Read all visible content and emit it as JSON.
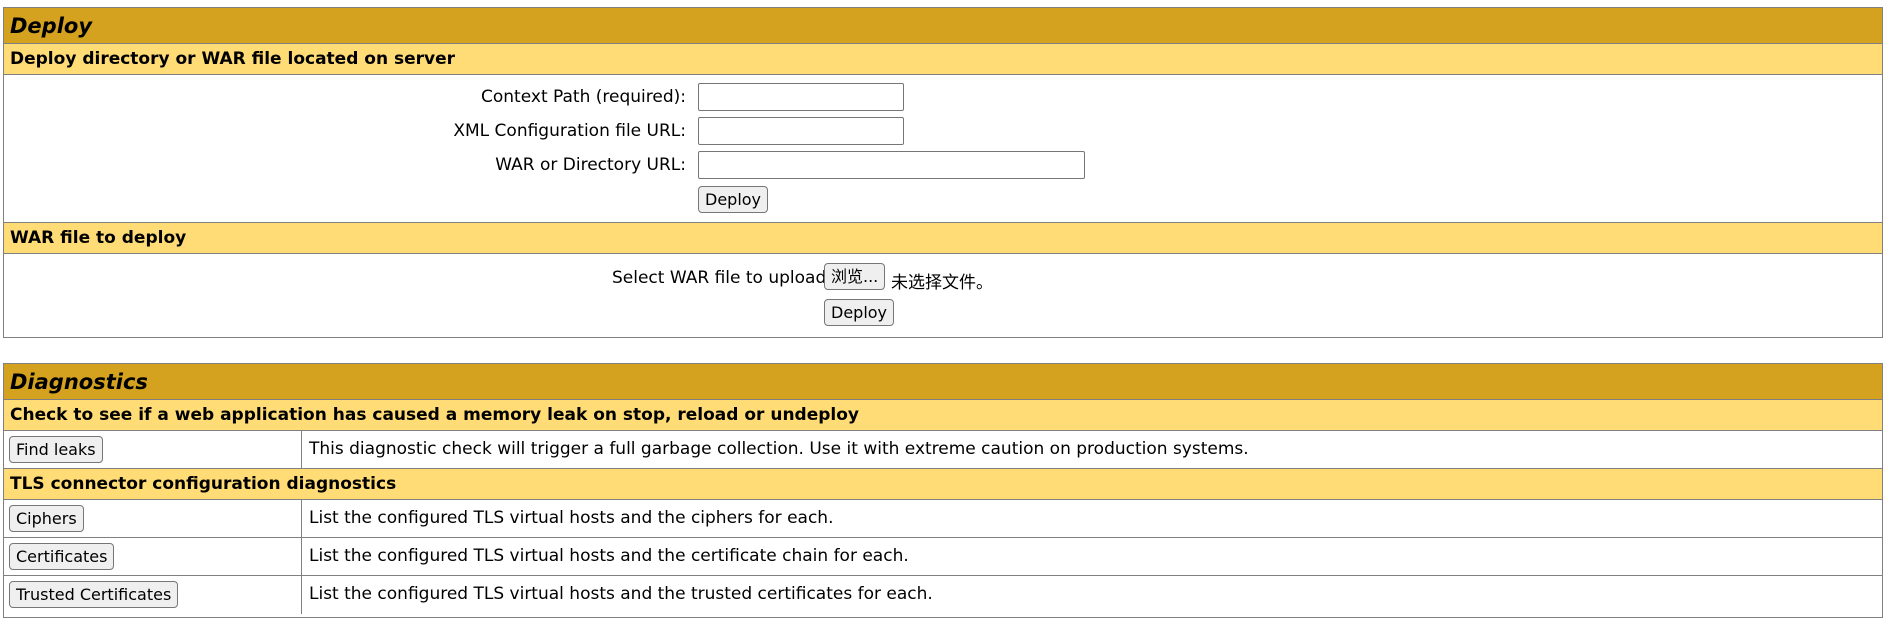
{
  "deploy": {
    "title": "Deploy",
    "server_section": {
      "heading": "Deploy directory or WAR file located on server",
      "context_path_label": "Context Path (required):",
      "context_path_value": "",
      "xml_config_label": "XML Configuration file URL:",
      "xml_config_value": "",
      "war_dir_label": "WAR or Directory URL:",
      "war_dir_value": "",
      "deploy_button": "Deploy"
    },
    "upload_section": {
      "heading": "WAR file to deploy",
      "select_label": "Select WAR file to upload",
      "browse_button": "浏览...",
      "no_file_text": "未选择文件。",
      "deploy_button": "Deploy"
    }
  },
  "diagnostics": {
    "title": "Diagnostics",
    "memory_leak_section": {
      "heading": "Check to see if a web application has caused a memory leak on stop, reload or undeploy",
      "rows": [
        {
          "button": "Find leaks",
          "description": "This diagnostic check will trigger a full garbage collection. Use it with extreme caution on production systems."
        }
      ]
    },
    "tls_section": {
      "heading": "TLS connector configuration diagnostics",
      "rows": [
        {
          "button": "Ciphers",
          "description": "List the configured TLS virtual hosts and the ciphers for each."
        },
        {
          "button": "Certificates",
          "description": "List the configured TLS virtual hosts and the certificate chain for each."
        },
        {
          "button": "Trusted Certificates",
          "description": "List the configured TLS virtual hosts and the trusted certificates for each."
        }
      ]
    }
  },
  "colors": {
    "panel_title_bg": "#d4a21e",
    "section_title_bg": "#ffdc75",
    "border": "#808080"
  }
}
